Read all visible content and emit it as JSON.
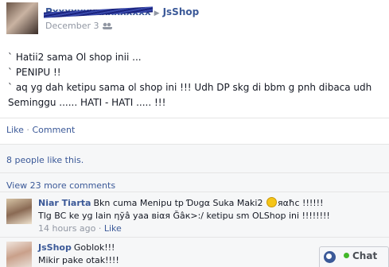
{
  "post": {
    "author_name": "Pxxxxxxxxxxxxxxxx",
    "arrow": "▶",
    "target_page": "JsShop",
    "date": "December 3",
    "privacy_icon": "friends-icon",
    "lines": [
      "` Hatii2 sama Ol shop inii ...",
      "` PENIPU !!",
      "` aq yg dah ketipu sama ol shop ini !!! Udh DP skg di bbm g pnh dibaca udh",
      "Seminggu ...... HATI - HATI ..... !!!"
    ]
  },
  "actions": {
    "like": "Like",
    "dot": " · ",
    "comment": "Comment"
  },
  "likes": {
    "text": "8 people like this."
  },
  "comments": {
    "view_more": "View 23 more comments",
    "items": [
      {
        "author": "Niar Tiarta",
        "text_a": "Bkn cuma Menipu tp Ɗυgα Suka Maki2 ",
        "emoticon": "smile-icon",
        "text_b": "яαħс !!!!!!",
        "line2": "Tlg BC ke yg lain ηўâ yaa віαя Ğâк>:/ ketipu sm OLShop ini !!!!!!!!",
        "meta_time": "14 hours ago",
        "meta_like": "Like"
      },
      {
        "author": "JsShop",
        "text_a": "Goblok!!!",
        "line2": "Mikir pake otak!!!!"
      }
    ]
  },
  "chat": {
    "label": "Chat",
    "status_color": "#42b72a"
  },
  "colors": {
    "link": "#3b5998",
    "muted": "#9197a3"
  }
}
